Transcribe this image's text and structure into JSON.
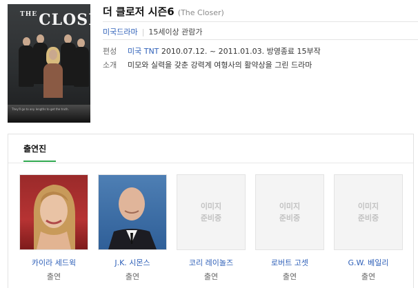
{
  "poster": {
    "logo_prefix": "THE",
    "logo_main": "CLOSER",
    "tagline": "They'll go to any lengths to get the truth."
  },
  "show": {
    "title": "더 클로저 시즌6",
    "title_en": "(The Closer)",
    "genre": "미국드라마",
    "rating": "15세이상 관람가",
    "info_label_schedule": "편성",
    "broadcaster": "미국 TNT",
    "schedule": "2010.07.12. ~ 2011.01.03. 방영종료 15부작",
    "info_label_intro": "소개",
    "intro": "미모와 실력을 갖춘 강력계 여형사의 활약상을 그린 드라마"
  },
  "cast": {
    "tab_label": "출연진",
    "placeholder_line1": "이미지",
    "placeholder_line2": "준비중",
    "members": [
      {
        "name": "카이라 세드윅",
        "role": "출연"
      },
      {
        "name": "J.K. 시몬스",
        "role": "출연"
      },
      {
        "name": "코리 레이놀즈",
        "role": "출연"
      },
      {
        "name": "로버트 고셋",
        "role": "출연"
      },
      {
        "name": "G.W. 베일리",
        "role": "출연"
      }
    ]
  },
  "colors": {
    "link": "#2d5fb8",
    "accent_green": "#2fa84f",
    "placeholder_bg": "#f4f4f4"
  }
}
